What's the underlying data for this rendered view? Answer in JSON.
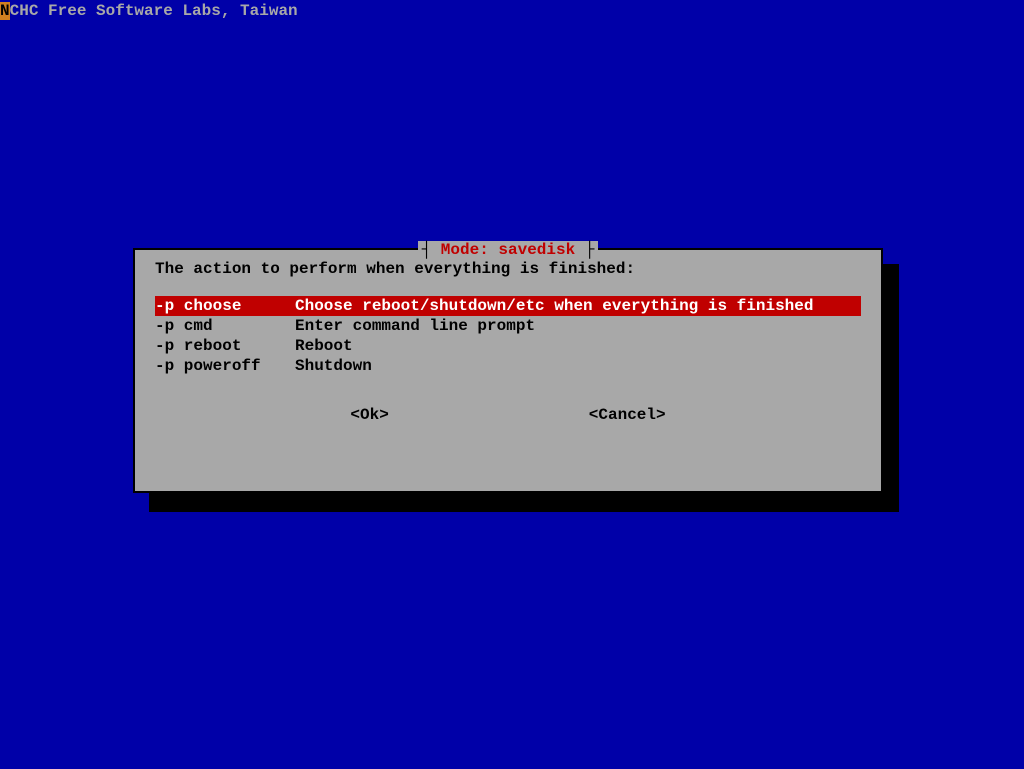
{
  "header": {
    "first_char": "N",
    "rest": "CHC Free Software Labs, Taiwan"
  },
  "dialog": {
    "title_open": "┤ ",
    "title_text": "Mode: savedisk",
    "title_close": " ├",
    "prompt": "The action to perform when everything is finished:",
    "menu": [
      {
        "flag": "-p choose",
        "desc": "Choose reboot/shutdown/etc when everything is finished",
        "selected": true
      },
      {
        "flag": "-p cmd",
        "desc": "Enter command line prompt",
        "selected": false
      },
      {
        "flag": "-p reboot",
        "desc": "Reboot",
        "selected": false
      },
      {
        "flag": "-p poweroff",
        "desc": "Shutdown",
        "selected": false
      }
    ],
    "buttons": {
      "ok": "<Ok>",
      "cancel": "<Cancel>"
    }
  }
}
